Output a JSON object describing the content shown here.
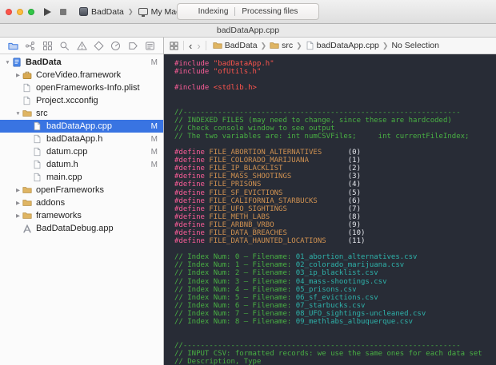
{
  "window": {
    "tab_title": "badDataApp.cpp"
  },
  "toolbar": {
    "scheme": "BadData",
    "destination": "My Mac",
    "status_primary": "Indexing",
    "status_secondary": "Processing files"
  },
  "colors": {
    "selection": "#3974e2",
    "editor_background": "#282c36",
    "comment_green": "#49b043",
    "preprocessor_pink": "#fb5d98",
    "string_red": "#fc544d",
    "macro_orange": "#cf9151",
    "filename_teal": "#2eb3ab"
  },
  "navigator": {
    "tabs": [
      {
        "name": "project-navigator",
        "icon": "project",
        "active": true
      },
      {
        "name": "source-control-navigator",
        "icon": "scm",
        "active": false
      },
      {
        "name": "symbol-navigator",
        "icon": "symbol",
        "active": false
      },
      {
        "name": "find-navigator",
        "icon": "find",
        "active": false
      },
      {
        "name": "issue-navigator",
        "icon": "issue",
        "active": false
      },
      {
        "name": "test-navigator",
        "icon": "test",
        "active": false
      },
      {
        "name": "debug-navigator",
        "icon": "debug",
        "active": false
      },
      {
        "name": "breakpoint-navigator",
        "icon": "breakpoint",
        "active": false
      },
      {
        "name": "report-navigator",
        "icon": "report",
        "active": false
      }
    ],
    "tree": [
      {
        "label": "BadData",
        "icon": "project",
        "disclosure": "open",
        "level": 0,
        "badge": "M",
        "bold": true
      },
      {
        "label": "CoreVideo.framework",
        "icon": "framework",
        "disclosure": "closed",
        "level": 1
      },
      {
        "label": "openFrameworks-Info.plist",
        "icon": "file",
        "level": 1
      },
      {
        "label": "Project.xcconfig",
        "icon": "file",
        "level": 1
      },
      {
        "label": "src",
        "icon": "folder",
        "disclosure": "open",
        "level": 1
      },
      {
        "label": "badDataApp.cpp",
        "icon": "file",
        "level": 2,
        "badge": "M",
        "selected": true
      },
      {
        "label": "badDataApp.h",
        "icon": "file",
        "level": 2,
        "badge": "M"
      },
      {
        "label": "datum.cpp",
        "icon": "file",
        "level": 2,
        "badge": "M"
      },
      {
        "label": "datum.h",
        "icon": "file",
        "level": 2,
        "badge": "M"
      },
      {
        "label": "main.cpp",
        "icon": "file",
        "level": 2
      },
      {
        "label": "openFrameworks",
        "icon": "folder",
        "disclosure": "closed",
        "level": 1
      },
      {
        "label": "addons",
        "icon": "folder",
        "disclosure": "closed",
        "level": 1
      },
      {
        "label": "frameworks",
        "icon": "folder",
        "disclosure": "closed",
        "level": 1
      },
      {
        "label": "BadDataDebug.app",
        "icon": "app",
        "level": 1
      }
    ]
  },
  "jumpbar": {
    "crumbs": [
      {
        "label": "BadData",
        "icon": "folder"
      },
      {
        "label": "src",
        "icon": "folder"
      },
      {
        "label": "badDataApp.cpp",
        "icon": "file"
      },
      {
        "label": "No Selection",
        "icon": ""
      }
    ]
  },
  "editor": {
    "lines": [
      [
        [
          "pp",
          "#include "
        ],
        [
          "str",
          "\"badDataApp.h\""
        ]
      ],
      [
        [
          "pp",
          "#include "
        ],
        [
          "str",
          "\"ofUtils.h\""
        ]
      ],
      [],
      [
        [
          "pp",
          "#include "
        ],
        [
          "str",
          "<stdlib.h>"
        ]
      ],
      [],
      [],
      [
        [
          "cm",
          "//----------------------------------------------------------------"
        ]
      ],
      [
        [
          "cm",
          "// INDEXED FILES (may need to change, since these are hardcoded)"
        ]
      ],
      [
        [
          "cm",
          "// Check console window to see output"
        ]
      ],
      [
        [
          "cm",
          "// The two variables are: int numCSVFiles;     int currentFileIndex;"
        ]
      ],
      [],
      [
        [
          "pp",
          "#define "
        ],
        [
          "mac",
          "FILE_ABORTION_ALTERNATIVES"
        ],
        [
          "pl",
          "      (0)"
        ]
      ],
      [
        [
          "pp",
          "#define "
        ],
        [
          "mac",
          "FILE_COLORADO_MARIJUANA"
        ],
        [
          "pl",
          "         (1)"
        ]
      ],
      [
        [
          "pp",
          "#define "
        ],
        [
          "mac",
          "FILE_IP_BLACKLIST"
        ],
        [
          "pl",
          "               (2)"
        ]
      ],
      [
        [
          "pp",
          "#define "
        ],
        [
          "mac",
          "FILE_MASS_SHOOTINGS"
        ],
        [
          "pl",
          "             (3)"
        ]
      ],
      [
        [
          "pp",
          "#define "
        ],
        [
          "mac",
          "FILE_PRISONS"
        ],
        [
          "pl",
          "                    (4)"
        ]
      ],
      [
        [
          "pp",
          "#define "
        ],
        [
          "mac",
          "FILE_SF_EVICTIONS"
        ],
        [
          "pl",
          "               (5)"
        ]
      ],
      [
        [
          "pp",
          "#define "
        ],
        [
          "mac",
          "FILE_CALIFORNIA_STARBUCKS"
        ],
        [
          "pl",
          "       (6)"
        ]
      ],
      [
        [
          "pp",
          "#define "
        ],
        [
          "mac",
          "FILE_UFO_SIGHTINGS"
        ],
        [
          "pl",
          "              (7)"
        ]
      ],
      [
        [
          "pp",
          "#define "
        ],
        [
          "mac",
          "FILE_METH_LABS"
        ],
        [
          "pl",
          "                  (8)"
        ]
      ],
      [
        [
          "pp",
          "#define "
        ],
        [
          "mac",
          "FILE_ARBNB_VRBO"
        ],
        [
          "pl",
          "                 (9)"
        ]
      ],
      [
        [
          "pp",
          "#define "
        ],
        [
          "mac",
          "FILE_DATA_BREACHES"
        ],
        [
          "pl",
          "              (10)"
        ]
      ],
      [
        [
          "pp",
          "#define "
        ],
        [
          "mac",
          "FILE_DATA_HAUNTED_LOCATIONS"
        ],
        [
          "pl",
          "     (11)"
        ]
      ],
      [],
      [
        [
          "cm",
          "// Index Num: 0 – Filename: "
        ],
        [
          "tl",
          "01_abortion_alternatives.csv"
        ]
      ],
      [
        [
          "cm",
          "// Index Num: 1 – Filename: "
        ],
        [
          "tl",
          "02_colorado_marijuana.csv"
        ]
      ],
      [
        [
          "cm",
          "// Index Num: 2 – Filename: "
        ],
        [
          "tl",
          "03_ip_blacklist.csv"
        ]
      ],
      [
        [
          "cm",
          "// Index Num: 3 – Filename: "
        ],
        [
          "tl",
          "04_mass-shootings.csv"
        ]
      ],
      [
        [
          "cm",
          "// Index Num: 4 – Filename: "
        ],
        [
          "tl",
          "05_prisons.csv"
        ]
      ],
      [
        [
          "cm",
          "// Index Num: 5 – Filename: "
        ],
        [
          "tl",
          "06_sf_evictions.csv"
        ]
      ],
      [
        [
          "cm",
          "// Index Num: 6 – Filename: "
        ],
        [
          "tl",
          "07_starbucks.csv"
        ]
      ],
      [
        [
          "cm",
          "// Index Num: 7 – Filename: "
        ],
        [
          "tl",
          "08_UFO_sightings-uncleaned.csv"
        ]
      ],
      [
        [
          "cm",
          "// Index Num: 8 – Filename: "
        ],
        [
          "tl",
          "09_methlabs_albuquerque.csv"
        ]
      ],
      [],
      [],
      [
        [
          "cm",
          "//----------------------------------------------------------------"
        ]
      ],
      [
        [
          "cm",
          "// INPUT CSV: formatted records: we use the same ones for each data set"
        ]
      ],
      [
        [
          "cm",
          "// Description, Type"
        ]
      ]
    ]
  }
}
